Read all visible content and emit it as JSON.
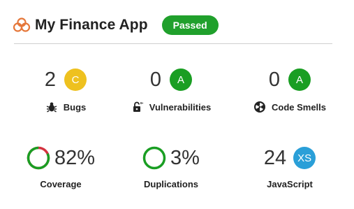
{
  "project": {
    "title": "My Finance App",
    "status": "Passed"
  },
  "colors": {
    "passed_green": "#20a02c",
    "grade_a": "#1a9e23",
    "grade_c": "#eec11f",
    "grade_xs": "#2a9fd8",
    "brand_orange": "#e5773a",
    "coverage_red": "#d4333f"
  },
  "metrics": {
    "bugs": {
      "value": "2",
      "grade": "C",
      "label": "Bugs",
      "icon": "bug-icon"
    },
    "vulnerabilities": {
      "value": "0",
      "grade": "A",
      "label": "Vulnerabilities",
      "icon": "lock-icon"
    },
    "code_smells": {
      "value": "0",
      "grade": "A",
      "label": "Code Smells",
      "icon": "radiation-icon"
    },
    "coverage": {
      "value": "82%",
      "label": "Coverage",
      "percent": 82
    },
    "duplications": {
      "value": "3%",
      "label": "Duplications",
      "percent": 3
    },
    "language": {
      "value": "24",
      "size": "XS",
      "label": "JavaScript"
    }
  }
}
